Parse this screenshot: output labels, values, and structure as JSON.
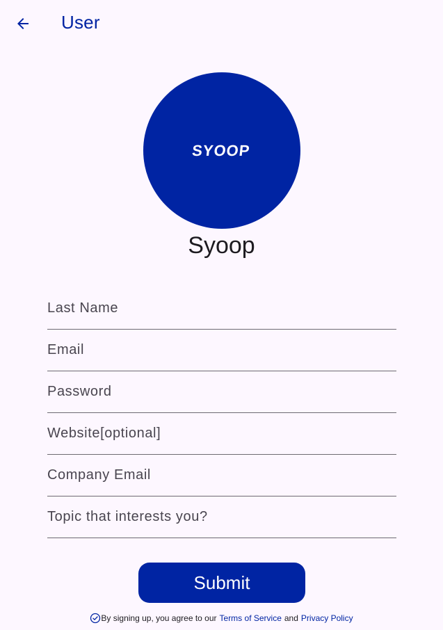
{
  "header": {
    "title": "User",
    "back_icon": "arrow-left-icon"
  },
  "profile": {
    "logo_text": "SYOOP",
    "name": "Syoop",
    "avatar_color": "#0024a3"
  },
  "form": {
    "fields": [
      {
        "label": "Last Name",
        "value": ""
      },
      {
        "label": "Email",
        "value": ""
      },
      {
        "label": "Password",
        "value": ""
      },
      {
        "label": "Website[optional]",
        "value": ""
      },
      {
        "label": "Company Email",
        "value": ""
      },
      {
        "label": "Topic that interests you?",
        "value": ""
      }
    ],
    "submit_label": "Submit"
  },
  "terms": {
    "icon": "check-circle-icon",
    "prefix": "By signing up, you agree to our",
    "terms_link": "Terms of Service",
    "and": "and",
    "privacy_link": "Privacy Policy"
  },
  "colors": {
    "brand": "#0024a3",
    "background": "#fdf7ff"
  }
}
